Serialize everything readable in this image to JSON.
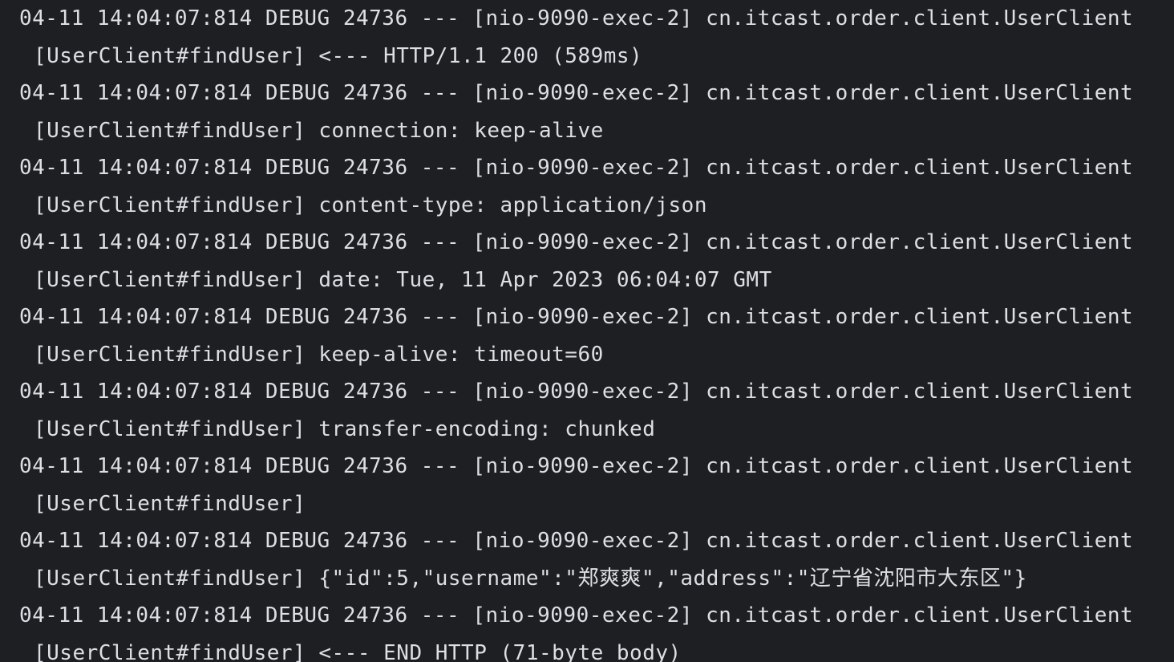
{
  "console": {
    "lines": [
      "04-11 14:04:07:814 DEBUG 24736 --- [nio-9090-exec-2] cn.itcast.order.client.UserClient",
      "[UserClient#findUser] <--- HTTP/1.1 200 (589ms)",
      "04-11 14:04:07:814 DEBUG 24736 --- [nio-9090-exec-2] cn.itcast.order.client.UserClient",
      "[UserClient#findUser] connection: keep-alive",
      "04-11 14:04:07:814 DEBUG 24736 --- [nio-9090-exec-2] cn.itcast.order.client.UserClient",
      "[UserClient#findUser] content-type: application/json",
      "04-11 14:04:07:814 DEBUG 24736 --- [nio-9090-exec-2] cn.itcast.order.client.UserClient",
      "[UserClient#findUser] date: Tue, 11 Apr 2023 06:04:07 GMT",
      "04-11 14:04:07:814 DEBUG 24736 --- [nio-9090-exec-2] cn.itcast.order.client.UserClient",
      "[UserClient#findUser] keep-alive: timeout=60",
      "04-11 14:04:07:814 DEBUG 24736 --- [nio-9090-exec-2] cn.itcast.order.client.UserClient",
      "[UserClient#findUser] transfer-encoding: chunked",
      "04-11 14:04:07:814 DEBUG 24736 --- [nio-9090-exec-2] cn.itcast.order.client.UserClient",
      "[UserClient#findUser]",
      "04-11 14:04:07:814 DEBUG 24736 --- [nio-9090-exec-2] cn.itcast.order.client.UserClient",
      "[UserClient#findUser] {\"id\":5,\"username\":\"郑爽爽\",\"address\":\"辽宁省沈阳市大东区\"}",
      "04-11 14:04:07:814 DEBUG 24736 --- [nio-9090-exec-2] cn.itcast.order.client.UserClient",
      "[UserClient#findUser] <--- END HTTP (71-byte body)"
    ]
  }
}
